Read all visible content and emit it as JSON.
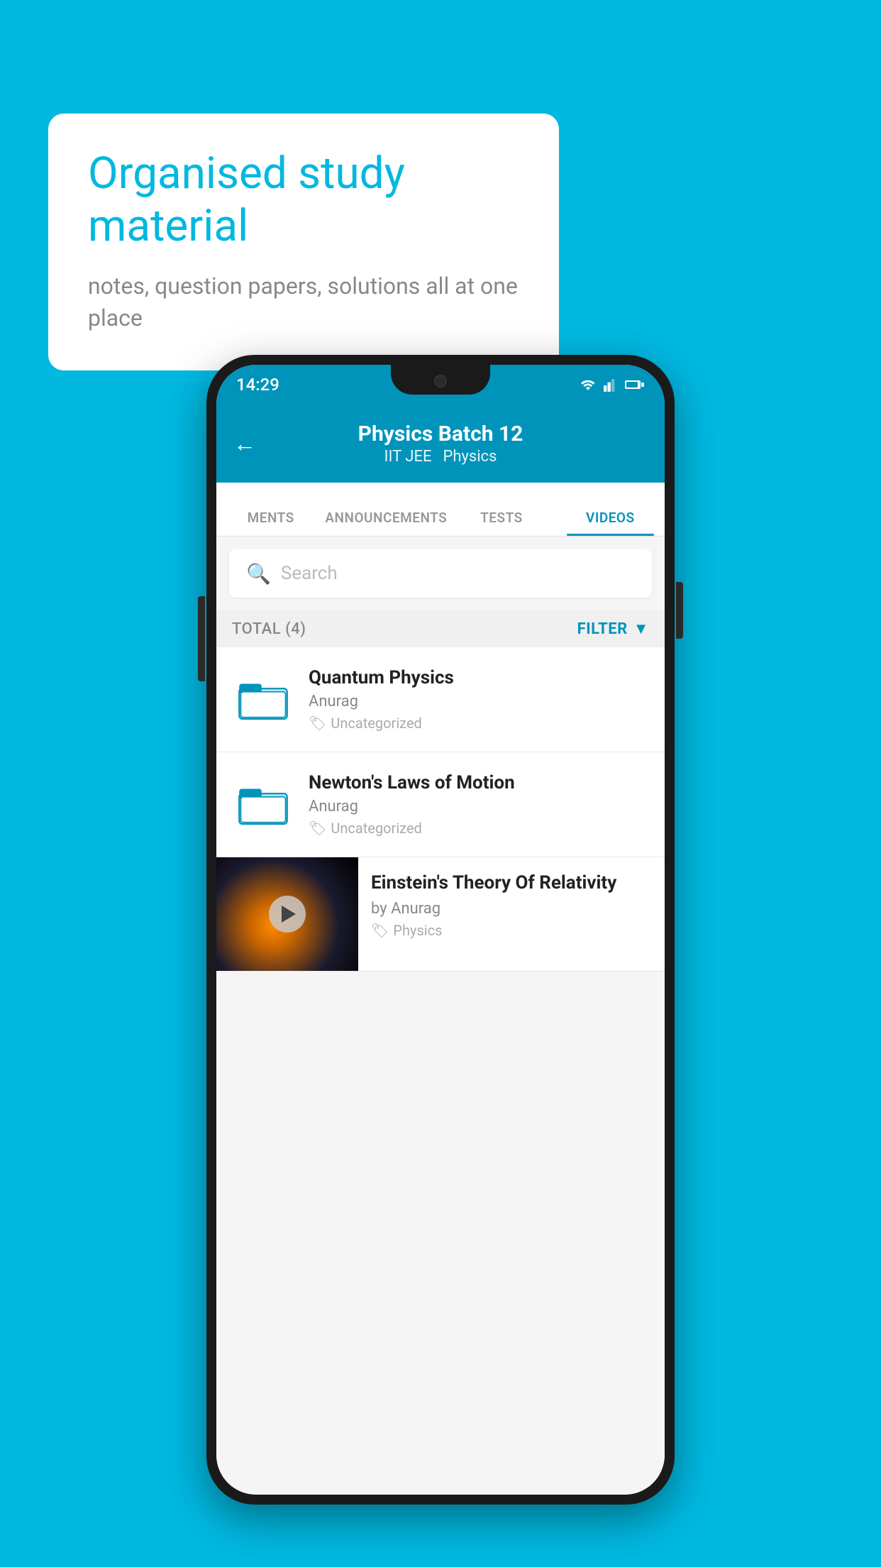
{
  "background_color": "#00b8e0",
  "speech_bubble": {
    "heading": "Organised study material",
    "subtext": "notes, question papers, solutions all at one place"
  },
  "phone": {
    "status_bar": {
      "time": "14:29"
    },
    "app_bar": {
      "title": "Physics Batch 12",
      "subtitle_tags": [
        "IIT JEE",
        "Physics"
      ],
      "back_label": "←"
    },
    "tabs": [
      {
        "label": "MENTS",
        "active": false
      },
      {
        "label": "ANNOUNCEMENTS",
        "active": false
      },
      {
        "label": "TESTS",
        "active": false
      },
      {
        "label": "VIDEOS",
        "active": true
      }
    ],
    "search": {
      "placeholder": "Search"
    },
    "filter_row": {
      "total_label": "TOTAL (4)",
      "filter_label": "FILTER"
    },
    "videos": [
      {
        "id": "quantum",
        "title": "Quantum Physics",
        "author": "Anurag",
        "tag": "Uncategorized",
        "has_thumbnail": false
      },
      {
        "id": "newton",
        "title": "Newton's Laws of Motion",
        "author": "Anurag",
        "tag": "Uncategorized",
        "has_thumbnail": false
      },
      {
        "id": "einstein",
        "title": "Einstein's Theory Of Relativity",
        "author": "by Anurag",
        "tag": "Physics",
        "has_thumbnail": true
      }
    ]
  }
}
